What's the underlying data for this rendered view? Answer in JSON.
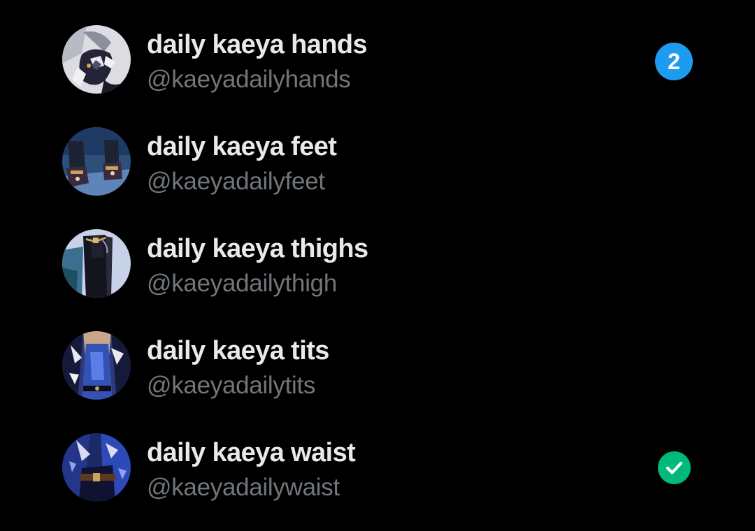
{
  "colors": {
    "background": "#000000",
    "display_name": "#e7e9ea",
    "handle": "#71767b",
    "unread_badge": "#1d9bf0",
    "active_check": "#00ba7c"
  },
  "accounts": [
    {
      "display_name": "daily kaeya hands",
      "handle": "@kaeyadailyhands",
      "avatar_icon": "hands-avatar",
      "unread_count": "2"
    },
    {
      "display_name": "daily kaeya feet",
      "handle": "@kaeyadailyfeet",
      "avatar_icon": "feet-avatar"
    },
    {
      "display_name": "daily kaeya thighs",
      "handle": "@kaeyadailythigh",
      "avatar_icon": "thighs-avatar"
    },
    {
      "display_name": "daily kaeya tits",
      "handle": "@kaeyadailytits",
      "avatar_icon": "chest-avatar"
    },
    {
      "display_name": "daily kaeya waist",
      "handle": "@kaeyadailywaist",
      "avatar_icon": "waist-avatar",
      "active_icon": "check-icon"
    }
  ]
}
